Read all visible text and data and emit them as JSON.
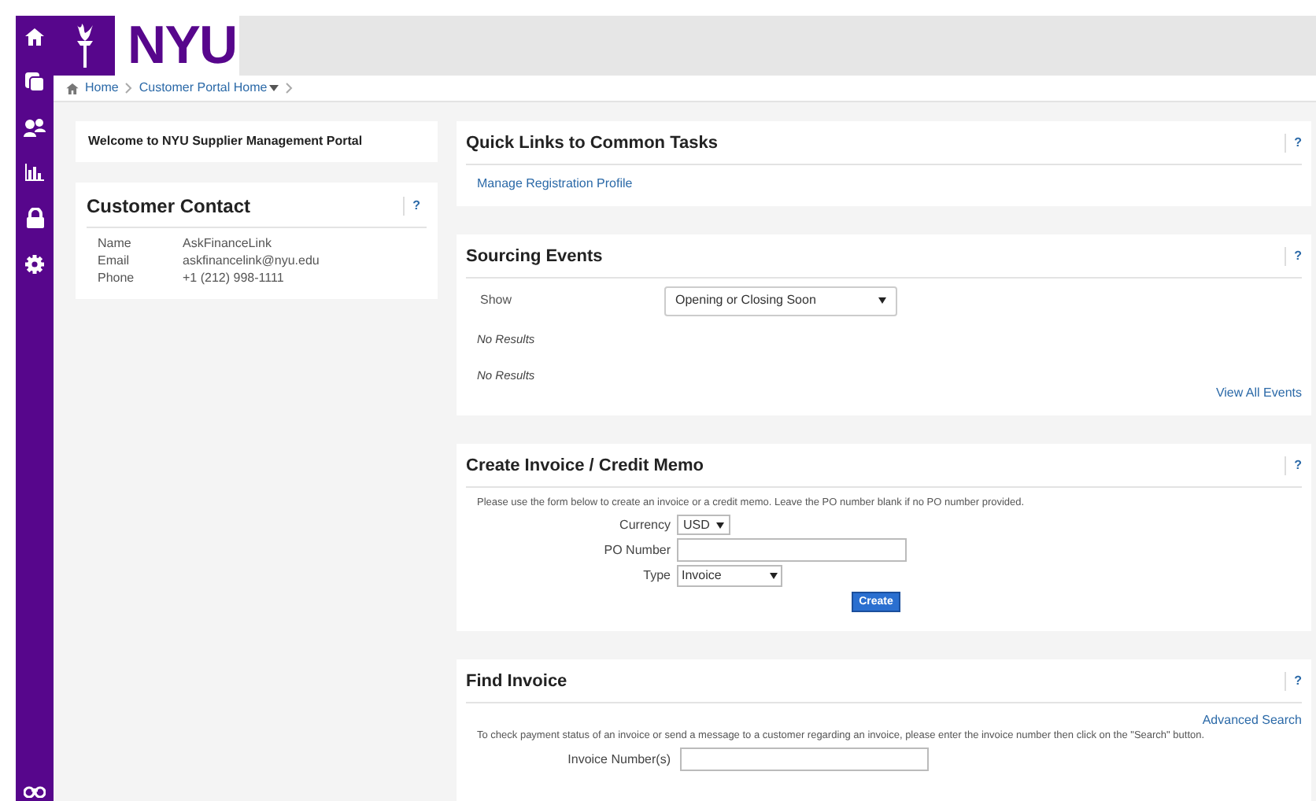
{
  "header": {
    "logo_text": "NYU"
  },
  "breadcrumb": [
    {
      "label": "Home",
      "has_menu": false
    },
    {
      "label": "Customer Portal Home",
      "has_menu": true
    }
  ],
  "welcome": {
    "text": "Welcome to NYU Supplier Management Portal"
  },
  "customer_contact": {
    "title": "Customer Contact",
    "help": "?",
    "fields": [
      {
        "label": "Name",
        "value": "AskFinanceLink"
      },
      {
        "label": "Email",
        "value": "askfinancelink@nyu.edu"
      },
      {
        "label": "Phone",
        "value": "+1 (212) 998-1111"
      }
    ]
  },
  "quick_links": {
    "title": "Quick Links to Common Tasks",
    "help": "?",
    "links": [
      "Manage Registration Profile"
    ]
  },
  "sourcing_events": {
    "title": "Sourcing Events",
    "help": "?",
    "show_label": "Show",
    "show_value": "Opening or Closing Soon",
    "results": [
      "No Results",
      "No Results"
    ],
    "view_all": "View All Events"
  },
  "create_invoice": {
    "title": "Create Invoice / Credit Memo",
    "help": "?",
    "instructions": "Please use the form below to create an invoice or a credit memo. Leave the PO number blank if no PO number provided.",
    "currency_label": "Currency",
    "currency_value": "USD",
    "po_label": "PO Number",
    "type_label": "Type",
    "type_value": "Invoice",
    "button": "Create"
  },
  "find_invoice": {
    "title": "Find Invoice",
    "help": "?",
    "advanced_search": "Advanced Search",
    "instructions": "To check payment status of an invoice or send a message to a customer regarding an invoice, please enter the invoice number then click on the \"Search\" button.",
    "invoice_label": "Invoice Number(s)"
  }
}
